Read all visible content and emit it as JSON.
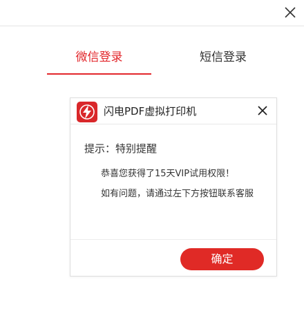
{
  "window": {
    "close_icon": "close-icon"
  },
  "tabs": [
    {
      "label": "微信登录",
      "active": true
    },
    {
      "label": "短信登录",
      "active": false
    }
  ],
  "dialog": {
    "app_icon": "lightning-app-icon",
    "title": "闪电PDF虚拟打印机",
    "close_icon": "close-icon",
    "heading": "提示：特别提醒",
    "messages": [
      "恭喜您获得了15天VIP试用权限！",
      "如有问题，请通过左下方按钮联系客服"
    ],
    "confirm_label": "确定"
  },
  "colors": {
    "accent": "#e2262b",
    "button": "#e02a26",
    "text": "#333333"
  }
}
